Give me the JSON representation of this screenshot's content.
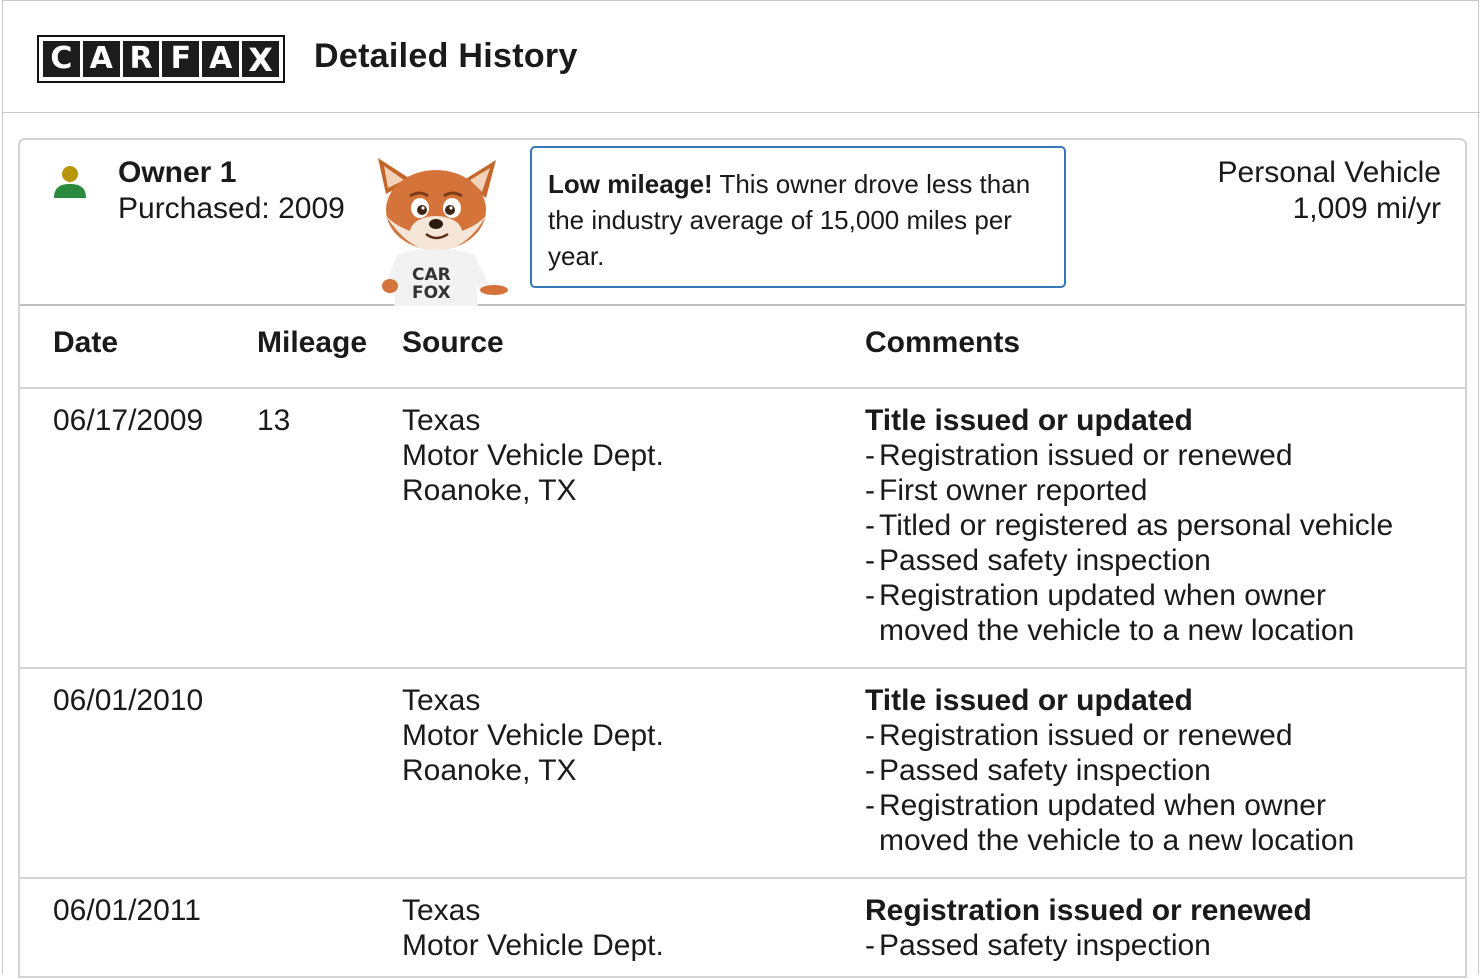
{
  "header": {
    "logo_letters": [
      "C",
      "A",
      "R",
      "F",
      "A",
      "X"
    ],
    "title": "Detailed History"
  },
  "owner": {
    "name": "Owner 1",
    "purchased": "Purchased: 2009",
    "icon": "person-icon",
    "icon_head_color": "#b8960c",
    "icon_body_color": "#2b8a3e",
    "mascot": "carfox-mascot",
    "mascot_shirt_text": "CAR FOX",
    "callout_bold": "Low mileage!",
    "callout_text": " This owner drove less than the industry average of 15,000 miles per year.",
    "vehicle_type": "Personal Vehicle",
    "mileage_rate": "1,009 mi/yr"
  },
  "table": {
    "columns": [
      "Date",
      "Mileage",
      "Source",
      "Comments"
    ],
    "rows": [
      {
        "date": "06/17/2009",
        "mileage": "13",
        "source": [
          "Texas",
          "Motor Vehicle Dept.",
          "Roanoke, TX"
        ],
        "comment_title": "Title issued or updated",
        "comment_items": [
          "Registration issued or renewed",
          "First owner reported",
          "Titled or registered as personal vehicle",
          "Passed safety inspection",
          "Registration updated when owner moved the vehicle to a new location"
        ]
      },
      {
        "date": "06/01/2010",
        "mileage": "",
        "source": [
          "Texas",
          "Motor Vehicle Dept.",
          "Roanoke, TX"
        ],
        "comment_title": "Title issued or updated",
        "comment_items": [
          "Registration issued or renewed",
          "Passed safety inspection",
          "Registration updated when owner moved the vehicle to a new location"
        ]
      },
      {
        "date": "06/01/2011",
        "mileage": "",
        "source": [
          "Texas",
          "Motor Vehicle Dept."
        ],
        "comment_title": "Registration issued or renewed",
        "comment_items": [
          "Passed safety inspection"
        ]
      }
    ]
  },
  "colors": {
    "callout_border": "#3777bc",
    "divider": "#d4d4d4",
    "text": "#1a1a1a"
  }
}
